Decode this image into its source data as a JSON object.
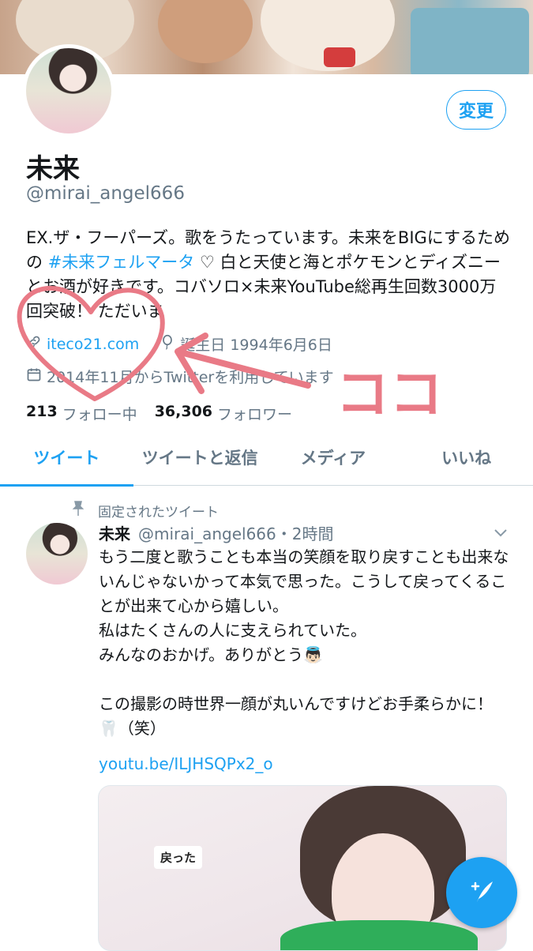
{
  "profile": {
    "display_name": "未来",
    "handle": "@mirai_angel666",
    "edit_label": "変更",
    "bio_pre": "EX.ザ・フーパーズ。歌をうたっています。未来をBIGにするための ",
    "bio_tag": "#未来フェルマータ",
    "bio_post": " ♡ 白と天使と海とポケモンとディズニーとお酒が好きです。コバソロ×未来YouTube総再生回数3000万回突破！ ただいま",
    "website": "iteco21.com",
    "birthday": "誕生日 1994年6月6日",
    "joined": "2014年11月からTwitterを利用しています",
    "following_count": "213",
    "following_label": "フォロー中",
    "followers_count": "36,306",
    "followers_label": "フォロワー"
  },
  "tabs": [
    {
      "label": "ツイート"
    },
    {
      "label": "ツイートと返信"
    },
    {
      "label": "メディア"
    },
    {
      "label": "いいね"
    }
  ],
  "pinned_tweet": {
    "pinned_label": "固定されたツイート",
    "name": "未来",
    "handle_time": "@mirai_angel666・2時間",
    "body": "もう二度と歌うことも本当の笑顔を取り戻すことも出来ないんじゃないかって本気で思った。こうして戻ってくることが出来て心から嬉しい。\n私はたくさんの人に支えられていた。\nみんなのおかげ。ありがとう👼🏻\n\nこの撮影の時世界一顔が丸いんですけどお手柔らかに！🦷（笑）",
    "link": "youtu.be/ILJHSQPx2_o",
    "media_caption": "戻った"
  },
  "annotation": {
    "text": "ココ",
    "color": "#e97a86"
  },
  "colors": {
    "accent": "#1da1f2",
    "secondary_text": "#657786"
  },
  "icons": {
    "link": "link-icon",
    "birthday": "balloon-icon",
    "calendar": "calendar-icon",
    "pin": "pin-icon",
    "compose": "compose-icon"
  }
}
